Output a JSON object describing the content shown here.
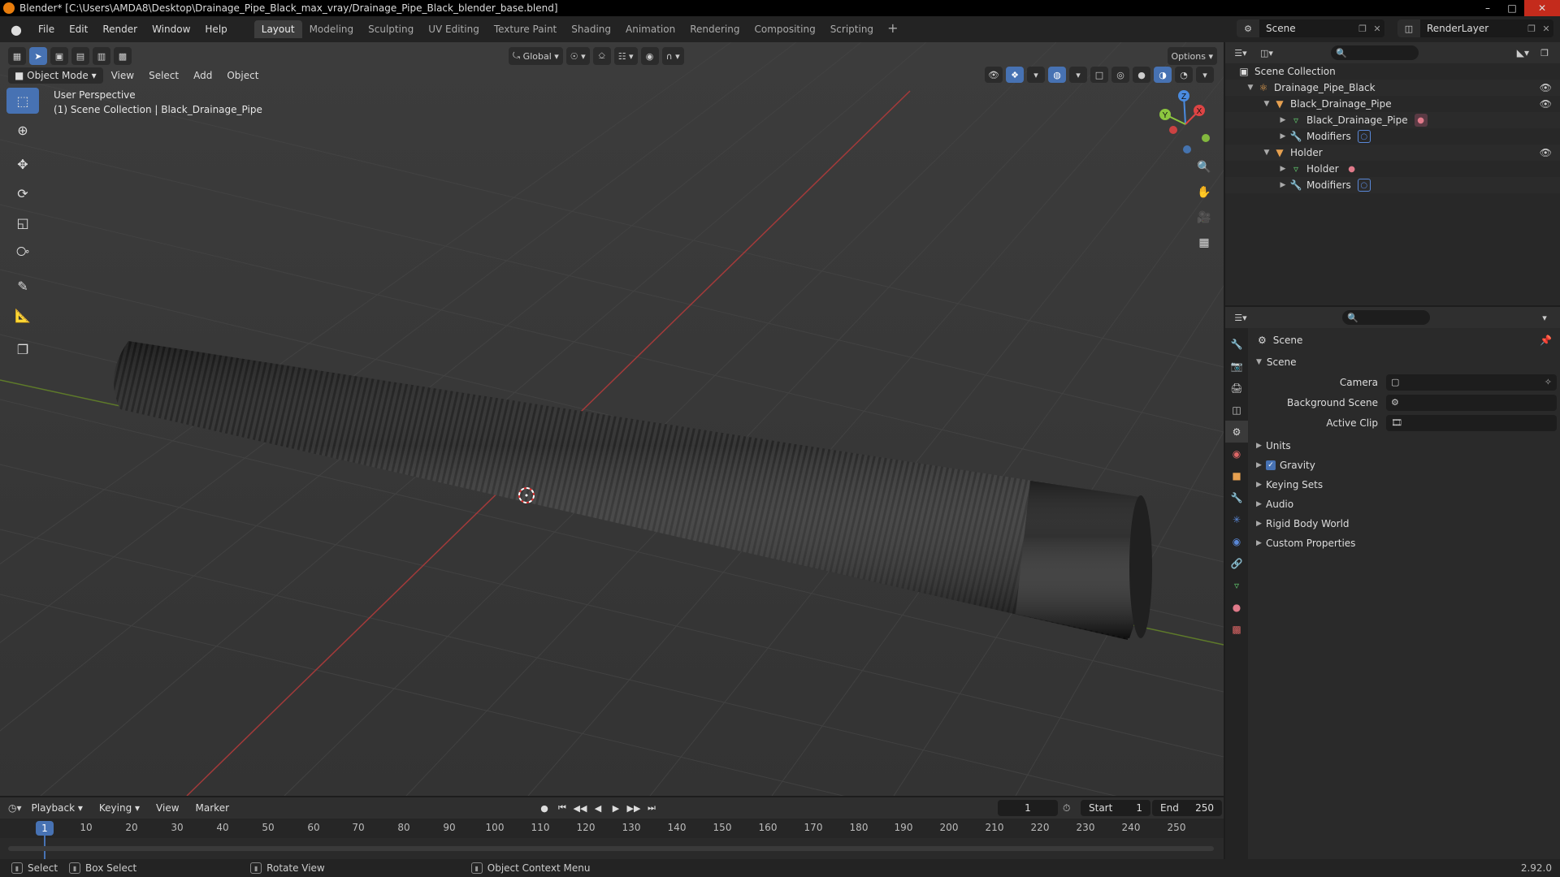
{
  "window": {
    "title": "Blender* [C:\\Users\\AMDA8\\Desktop\\Drainage_Pipe_Black_max_vray/Drainage_Pipe_Black_blender_base.blend]",
    "controls": [
      "–",
      "□",
      "✕"
    ]
  },
  "menu": {
    "items": [
      "File",
      "Edit",
      "Render",
      "Window",
      "Help"
    ]
  },
  "workspaces": {
    "tabs": [
      "Layout",
      "Modeling",
      "Sculpting",
      "UV Editing",
      "Texture Paint",
      "Shading",
      "Animation",
      "Rendering",
      "Compositing",
      "Scripting"
    ],
    "active": "Layout",
    "add": "+"
  },
  "scene_selector": {
    "label": "Scene"
  },
  "renderlayer_selector": {
    "label": "RenderLayer"
  },
  "viewport": {
    "transform_orientation": "Global",
    "options_label": "Options",
    "mode": "Object Mode",
    "header_menus": [
      "View",
      "Select",
      "Add",
      "Object"
    ],
    "info_line1": "User Perspective",
    "info_line2": "(1) Scene Collection | Black_Drainage_Pipe",
    "gizmo_axes": {
      "x": "X",
      "y": "Y",
      "z": "Z"
    }
  },
  "outliner": {
    "rows": [
      {
        "label": "Scene Collection",
        "indent": 0,
        "icon": "collection-icon",
        "eye": false
      },
      {
        "label": "Drainage_Pipe_Black",
        "indent": 1,
        "icon": "armature-icon",
        "eye": true
      },
      {
        "label": "Black_Drainage_Pipe",
        "indent": 2,
        "icon": "object-icon",
        "eye": true
      },
      {
        "label": "Black_Drainage_Pipe",
        "indent": 3,
        "icon": "mesh-icon",
        "eye": false
      },
      {
        "label": "Modifiers",
        "indent": 3,
        "icon": "wrench-icon",
        "eye": false
      },
      {
        "label": "Holder",
        "indent": 2,
        "icon": "object-icon",
        "eye": true
      },
      {
        "label": "Holder",
        "indent": 3,
        "icon": "mesh-icon",
        "eye": false
      },
      {
        "label": "Modifiers",
        "indent": 3,
        "icon": "wrench-icon",
        "eye": false
      }
    ]
  },
  "properties": {
    "context_title": "Scene",
    "panel_title": "Scene",
    "fields": [
      {
        "label": "Camera"
      },
      {
        "label": "Background Scene"
      },
      {
        "label": "Active Clip"
      }
    ],
    "subpanels": [
      "Units",
      "Gravity",
      "Keying Sets",
      "Audio",
      "Rigid Body World",
      "Custom Properties"
    ],
    "gravity_checked": true
  },
  "timeline": {
    "menus": [
      "Playback",
      "Keying",
      "View",
      "Marker"
    ],
    "current_frame": "1",
    "start_label": "Start",
    "start": "1",
    "end_label": "End",
    "end": "250",
    "ruler": [
      "10",
      "20",
      "30",
      "40",
      "50",
      "60",
      "70",
      "80",
      "90",
      "100",
      "110",
      "120",
      "130",
      "140",
      "150",
      "160",
      "170",
      "180",
      "190",
      "200",
      "210",
      "220",
      "230",
      "240",
      "250"
    ]
  },
  "statusbar": {
    "select": "Select",
    "box_select": "Box Select",
    "rotate_view": "Rotate View",
    "context_menu": "Object Context Menu",
    "version": "2.92.0"
  },
  "colors": {
    "accent": "#4772b3",
    "x_axis": "#d44",
    "y_axis": "#8cc63f",
    "z_axis": "#4a8be0"
  }
}
